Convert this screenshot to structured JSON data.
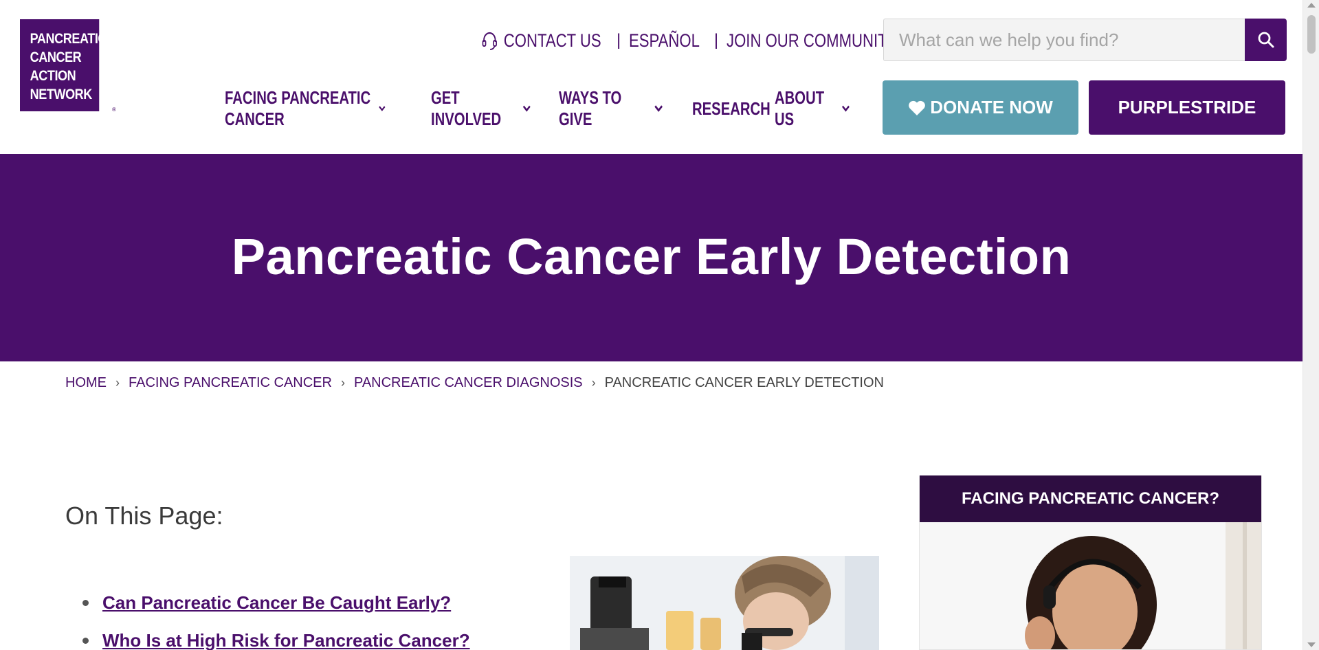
{
  "logo": {
    "lines": [
      "PANCREATIC",
      "CANCER",
      "ACTION",
      "NETWORK"
    ],
    "registered": "®"
  },
  "utility": {
    "contact": "CONTACT US",
    "espanol": "ESPAÑOL",
    "join": "JOIN OUR COMMUNITY",
    "separator": "|"
  },
  "search": {
    "placeholder": "What can we help you find?",
    "value": ""
  },
  "nav": {
    "items": [
      {
        "label": "FACING PANCREATIC CANCER",
        "has_dropdown": true
      },
      {
        "label": "GET INVOLVED",
        "has_dropdown": true
      },
      {
        "label": "WAYS TO GIVE",
        "has_dropdown": true
      },
      {
        "label": "RESEARCH",
        "has_dropdown": false
      },
      {
        "label": "ABOUT US",
        "has_dropdown": true
      }
    ]
  },
  "buttons": {
    "donate": "DONATE NOW",
    "purplestride": "PURPLESTRIDE"
  },
  "hero": {
    "title": "Pancreatic Cancer Early Detection"
  },
  "breadcrumb": {
    "items": [
      "HOME",
      "FACING PANCREATIC CANCER",
      "PANCREATIC CANCER DIAGNOSIS",
      "PANCREATIC CANCER EARLY DETECTION"
    ],
    "separator": "›"
  },
  "on_this_page": {
    "title": "On This Page:",
    "links": [
      "Can Pancreatic Cancer Be Caught Early?",
      "Who Is at High Risk for Pancreatic Cancer?"
    ]
  },
  "sidebar": {
    "heading": "FACING PANCREATIC CANCER?"
  },
  "colors": {
    "brand_purple": "#4a0f6b",
    "donate_teal": "#5b9fb0",
    "sidebar_dark": "#2e0d41"
  }
}
